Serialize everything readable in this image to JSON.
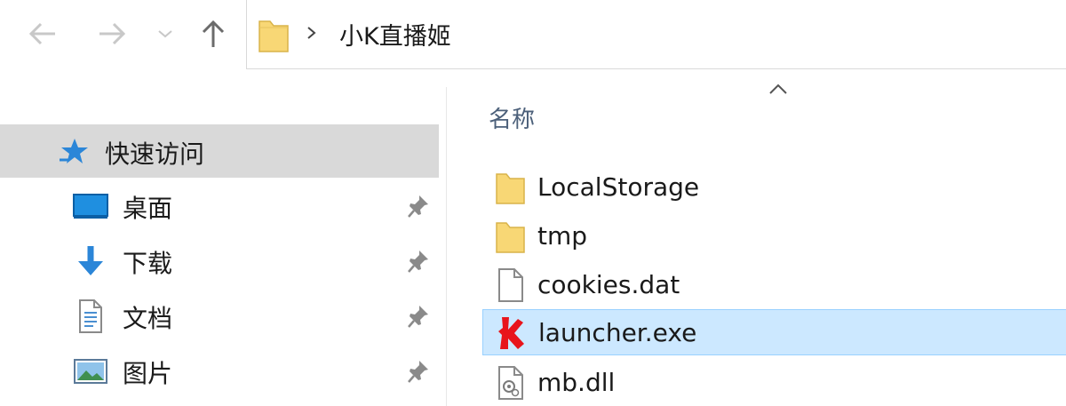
{
  "address": {
    "path": "小K直播姬"
  },
  "quick_access": {
    "label": "快速访问"
  },
  "nav_items": [
    {
      "label": "桌面",
      "icon": "desktop-icon"
    },
    {
      "label": "下载",
      "icon": "download-icon"
    },
    {
      "label": "文档",
      "icon": "document-icon"
    },
    {
      "label": "图片",
      "icon": "pictures-icon"
    }
  ],
  "file_list": {
    "column_name": "名称",
    "files": [
      {
        "name": "LocalStorage",
        "icon": "folder-icon",
        "selected": false
      },
      {
        "name": "tmp",
        "icon": "folder-icon",
        "selected": false
      },
      {
        "name": "cookies.dat",
        "icon": "file-icon",
        "selected": false
      },
      {
        "name": "launcher.exe",
        "icon": "app-icon",
        "selected": true
      },
      {
        "name": "mb.dll",
        "icon": "dll-icon",
        "selected": false
      }
    ]
  },
  "colors": {
    "selection_bg": "#cce8ff",
    "selection_border": "#99d1ff",
    "quick_access_bg": "#d9d9d9",
    "folder_yellow": "#f8d775"
  }
}
